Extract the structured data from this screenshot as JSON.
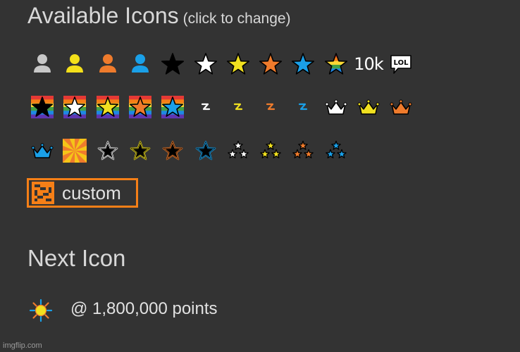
{
  "header": {
    "title": "Available Icons",
    "subtitle": "(click to change)"
  },
  "icons": [
    {
      "name": "person-gray-icon",
      "type": "person",
      "color": "#c8c8c8"
    },
    {
      "name": "person-yellow-icon",
      "type": "person",
      "color": "#f4e01a"
    },
    {
      "name": "person-orange-icon",
      "type": "person",
      "color": "#ef7b2c"
    },
    {
      "name": "person-blue-icon",
      "type": "person",
      "color": "#1aa0e8"
    },
    {
      "name": "star-black-icon",
      "type": "star",
      "color": "#000000"
    },
    {
      "name": "star-white-icon",
      "type": "star",
      "color": "#ffffff"
    },
    {
      "name": "star-yellow-icon",
      "type": "star",
      "color": "#f0e020"
    },
    {
      "name": "star-orange-icon",
      "type": "star",
      "color": "#ef7b2c"
    },
    {
      "name": "star-blue-icon",
      "type": "star",
      "color": "#1aa0e8"
    },
    {
      "name": "star-rainbow-icon",
      "type": "star",
      "color": "rainbow"
    },
    {
      "name": "ten-k-icon",
      "type": "text",
      "text": "10k"
    },
    {
      "name": "lol-speech-bubble-icon",
      "type": "lol",
      "text": "LOL"
    },
    {
      "name": "rainbow-star-black-icon",
      "type": "rainbowstar",
      "color": "#000000"
    },
    {
      "name": "rainbow-star-white-icon",
      "type": "rainbowstar",
      "color": "#ffffff"
    },
    {
      "name": "rainbow-star-yellow-icon",
      "type": "rainbowstar",
      "color": "#f0e020"
    },
    {
      "name": "rainbow-star-orange-icon",
      "type": "rainbowstar",
      "color": "#ef7b2c"
    },
    {
      "name": "rainbow-star-blue-icon",
      "type": "rainbowstar",
      "color": "#1aa0e8"
    },
    {
      "name": "lightning-white-icon",
      "type": "bolt",
      "color": "#ffffff"
    },
    {
      "name": "lightning-yellow-icon",
      "type": "bolt",
      "color": "#f0e020"
    },
    {
      "name": "lightning-orange-icon",
      "type": "bolt",
      "color": "#ef7b2c"
    },
    {
      "name": "lightning-blue-icon",
      "type": "bolt",
      "color": "#1aa0e8"
    },
    {
      "name": "crown-white-icon",
      "type": "crown",
      "color": "#ffffff"
    },
    {
      "name": "crown-yellow-icon",
      "type": "crown",
      "color": "#f0e020"
    },
    {
      "name": "crown-orange-icon",
      "type": "crown",
      "color": "#ef7b2c"
    },
    {
      "name": "crown-blue-icon",
      "type": "crown",
      "color": "#1aa0e8"
    },
    {
      "name": "pinwheel-icon",
      "type": "pinwheel",
      "color": "#f5c518"
    },
    {
      "name": "star-outline-white-icon",
      "type": "ostar",
      "color": "#ffffff"
    },
    {
      "name": "star-outline-yellow-icon",
      "type": "ostar",
      "color": "#f0e020"
    },
    {
      "name": "star-outline-orange-icon",
      "type": "ostar",
      "color": "#ef7b2c"
    },
    {
      "name": "star-outline-blue-icon",
      "type": "ostar",
      "color": "#1aa0e8"
    },
    {
      "name": "triple-star-white-icon",
      "type": "tristar",
      "color": "#ffffff"
    },
    {
      "name": "triple-star-yellow-icon",
      "type": "tristar",
      "color": "#f0e020"
    },
    {
      "name": "triple-star-orange-icon",
      "type": "tristar",
      "color": "#ef7b2c"
    },
    {
      "name": "triple-star-blue-icon",
      "type": "tristar",
      "color": "#1aa0e8"
    }
  ],
  "custom": {
    "label": "custom",
    "accent": "#f57f17"
  },
  "next": {
    "title": "Next Icon",
    "points": "@ 1,800,000 points",
    "icon": "sun-icon"
  },
  "watermark": "imgflip.com",
  "rainbow": [
    "#e53935",
    "#f57f17",
    "#fdd835",
    "#43a047",
    "#1e88e5",
    "#5e35b1"
  ]
}
